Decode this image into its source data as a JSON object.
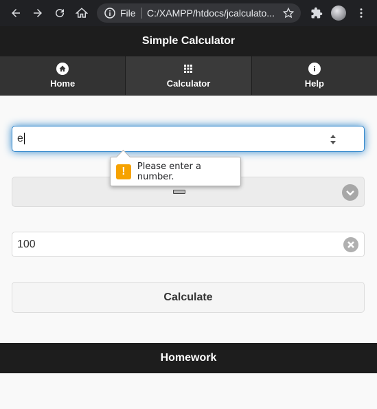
{
  "browser": {
    "omnibox_scheme_label": "File",
    "omnibox_url": "C:/XAMPP/htdocs/jcalculato..."
  },
  "app": {
    "title": "Simple Calculator",
    "nav": [
      {
        "label": "Home",
        "icon": "home-icon"
      },
      {
        "label": "Calculator",
        "icon": "grid-icon"
      },
      {
        "label": "Help",
        "icon": "info-icon"
      }
    ]
  },
  "form": {
    "first_number_value": "e",
    "validation_message": "Please enter a number.",
    "operator_value": "−",
    "second_number_value": "100",
    "calculate_label": "Calculate"
  },
  "footer": {
    "title": "Homework"
  },
  "colors": {
    "header_bg": "#1d1d1d",
    "focus_glow": "#3388cc",
    "warning": "#f6a200"
  }
}
